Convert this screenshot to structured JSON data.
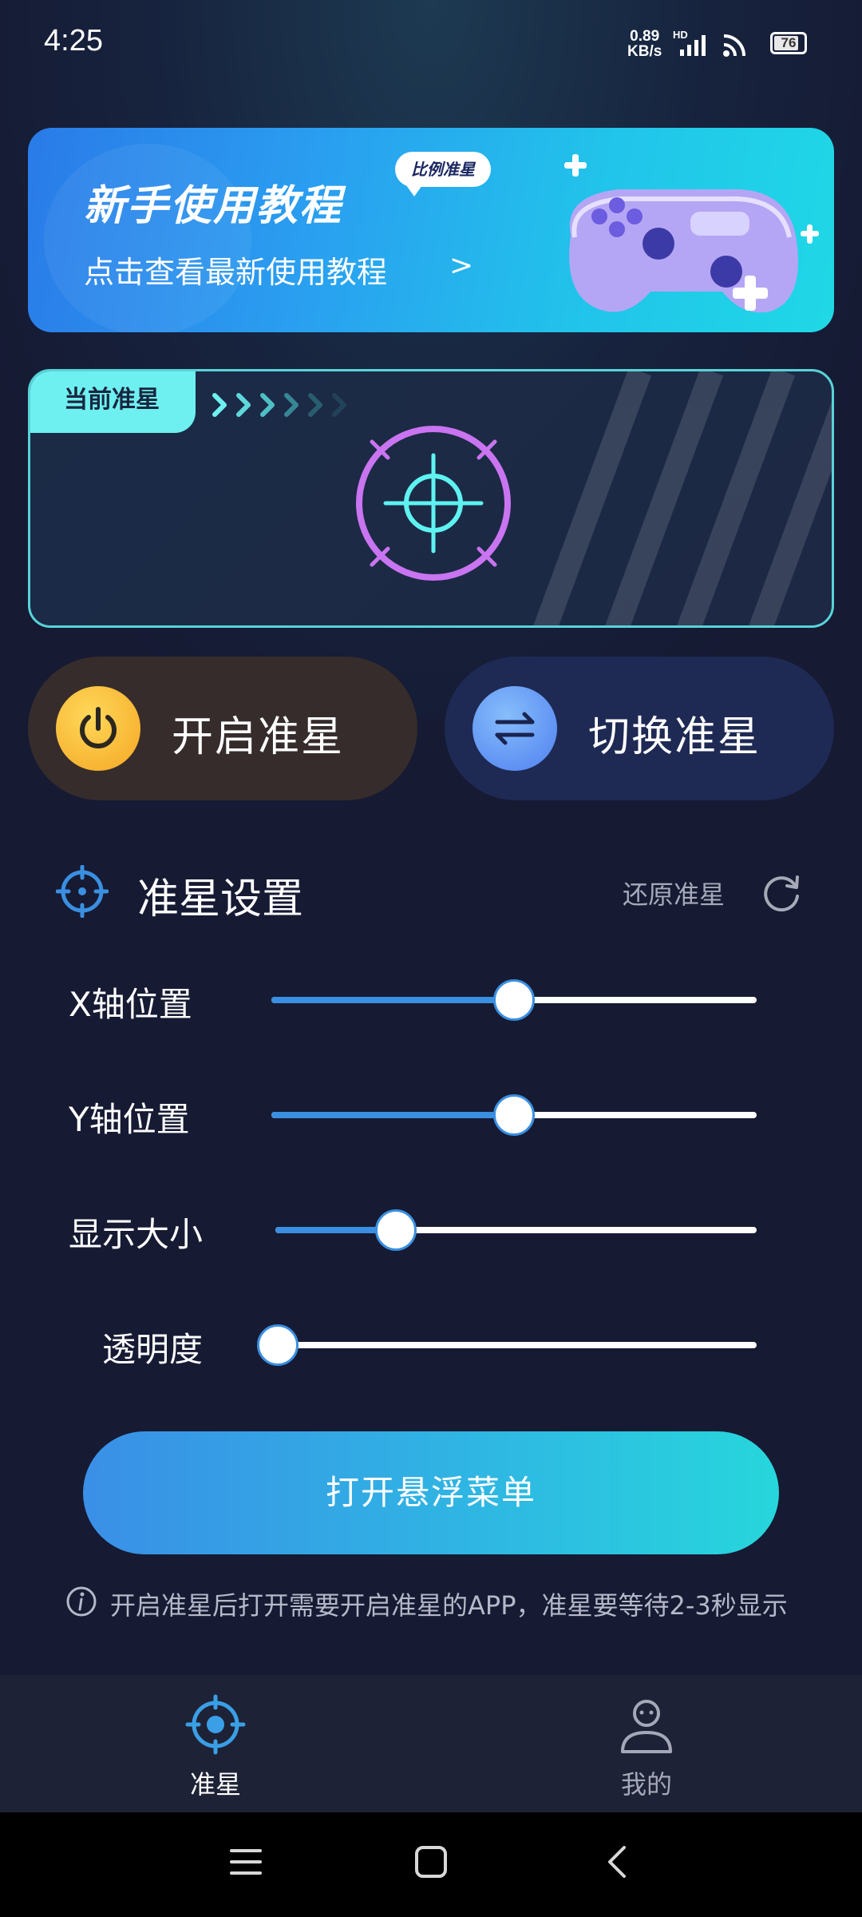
{
  "status_bar": {
    "time": "4:25",
    "net_speed_value": "0.89",
    "net_speed_unit": "KB/s",
    "network_tag": "HD",
    "battery_level": "76",
    "icons": [
      "signal-icon",
      "cast-icon",
      "battery-icon"
    ]
  },
  "banner": {
    "title": "新手使用教程",
    "badge": "比例准星",
    "subtitle": "点击查看最新使用教程",
    "chevron": ">"
  },
  "preview": {
    "tab_label": "当前准星",
    "crosshair_color": "#c974f0",
    "crosshair_center_color": "#5ef2f0"
  },
  "actions": {
    "open_label": "开启准星",
    "switch_label": "切换准星"
  },
  "settings": {
    "title": "准星设置",
    "reset_label": "还原准星",
    "sliders": [
      {
        "label": "X轴位置",
        "value": 0.5
      },
      {
        "label": "Y轴位置",
        "value": 0.5
      },
      {
        "label": "显示大小",
        "value": 0.25
      },
      {
        "label": "透明度",
        "value": 0.0
      }
    ]
  },
  "cta": {
    "label": "打开悬浮菜单"
  },
  "tip": {
    "text": "开启准星后打开需要开启准星的APP，准星要等待2-3秒显示"
  },
  "bottom_nav": {
    "items": [
      {
        "label": "准星",
        "icon": "crosshair-icon",
        "active": true
      },
      {
        "label": "我的",
        "icon": "person-icon",
        "active": false
      }
    ]
  },
  "colors": {
    "accent_blue": "#3a8fe0",
    "accent_cyan": "#27d6dc",
    "background": "#161a33",
    "power_yellow": "#f5a623"
  }
}
